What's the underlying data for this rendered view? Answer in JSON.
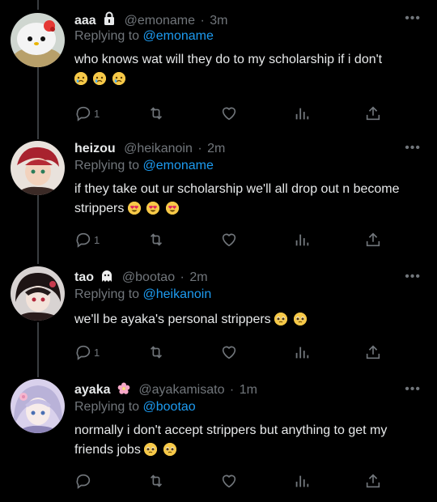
{
  "tweets": [
    {
      "name": "aaa",
      "handle": "@emoname",
      "time": "3m",
      "replying_label": "Replying to",
      "replying_to": "@emoname",
      "text": "who knows wat will they do to my scholarship if i don't",
      "emojis": [
        "crying-face",
        "crying-face",
        "crying-face"
      ],
      "reply_count": "1",
      "badge": "lock-icon"
    },
    {
      "name": "heizou",
      "handle": "@heikanoin",
      "time": "2m",
      "replying_label": "Replying to",
      "replying_to": "@emoname",
      "text": "if they take out ur scholarship we'll all drop out n become strippers",
      "emojis": [
        "heart-eyes-face",
        "heart-eyes-face",
        "heart-eyes-face"
      ],
      "reply_count": "1",
      "badge": ""
    },
    {
      "name": "tao",
      "handle": "@bootao",
      "time": "2m",
      "replying_label": "Replying to",
      "replying_to": "@heikanoin",
      "text": "we'll be ayaka's personal strippers",
      "emojis": [
        "pleading-face",
        "pleading-face"
      ],
      "reply_count": "1",
      "badge": "ghost-icon"
    },
    {
      "name": "ayaka",
      "handle": "@ayakamisato",
      "time": "1m",
      "replying_label": "Replying to",
      "replying_to": "@bootao",
      "text": "normally i don't accept strippers but anything to get my friends jobs",
      "emojis": [
        "pleading-face",
        "pleading-face"
      ],
      "reply_count": "",
      "badge": "cherry-blossom-icon"
    }
  ],
  "colors": {
    "background": "#000000",
    "text": "#e7e9ea",
    "muted": "#71767b",
    "link": "#1d9bf0"
  }
}
